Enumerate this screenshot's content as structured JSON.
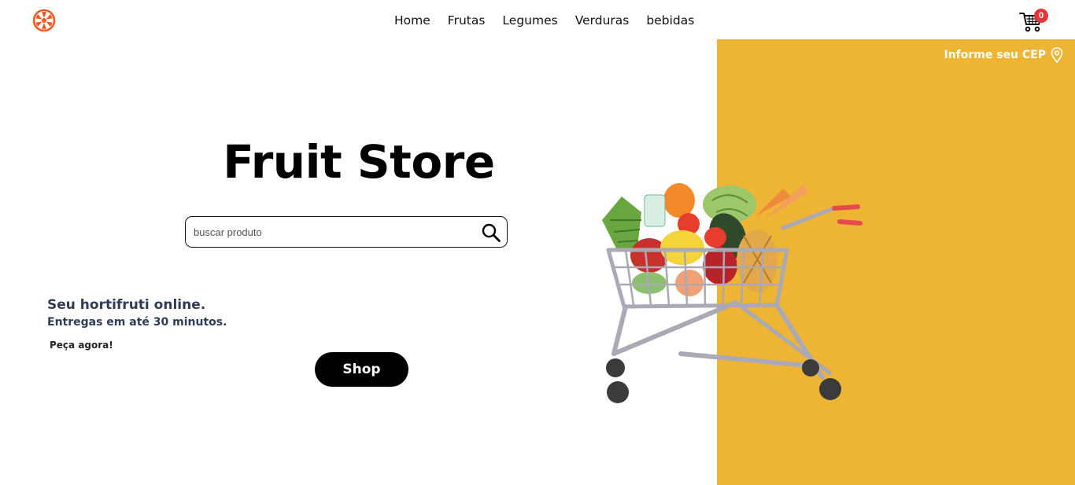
{
  "header": {
    "logo_icon": "orange-slice-logo",
    "nav": [
      "Home",
      "Frutas",
      "Legumes",
      "Verduras",
      "bebidas"
    ],
    "cart_icon": "shopping-cart-icon",
    "cart_count": "0"
  },
  "location": {
    "label": "Informe seu CEP",
    "icon": "map-pin-icon"
  },
  "hero": {
    "title": "Fruit Store",
    "search_placeholder": "buscar produto",
    "search_icon": "search-icon",
    "tagline": "Seu hortifruti online.",
    "delivery": "Entregas em até 30 minutos.",
    "cta_text": "Peça agora!",
    "shop_button": "Shop",
    "illustration": "shopping-cart-full-of-vegetables"
  },
  "colors": {
    "accent_yellow": "#eeb534",
    "logo_orange": "#f05a22",
    "badge_red": "#e8343c",
    "text_dark_blue": "#2e3d55"
  }
}
